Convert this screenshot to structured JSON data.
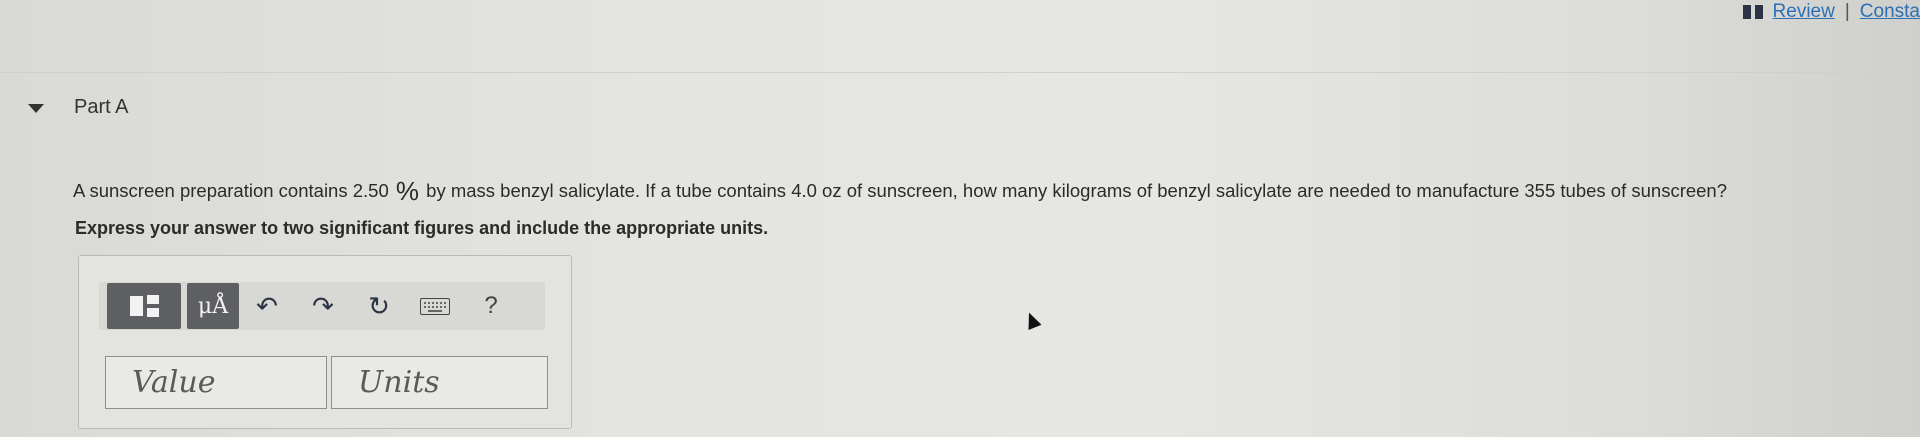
{
  "header": {
    "review_label": "Review",
    "separator": "|",
    "constants_label": "Consta"
  },
  "part": {
    "title": "Part A",
    "question_before": "A sunscreen preparation contains 2.50 ",
    "percent_symbol": "%",
    "question_after": " by mass benzyl salicylate. If a tube contains 4.0 oz of sunscreen, how many kilograms of benzyl salicylate are needed to manufacture 355 tubes of sunscreen?",
    "instruction": "Express your answer to two significant figures and include the appropriate units."
  },
  "toolbar": {
    "units_label": "μÅ",
    "undo_glyph": "↶",
    "redo_glyph": "↷",
    "reset_glyph": "↻",
    "help_label": "?"
  },
  "answer": {
    "value_placeholder": "Value",
    "units_placeholder": "Units"
  }
}
